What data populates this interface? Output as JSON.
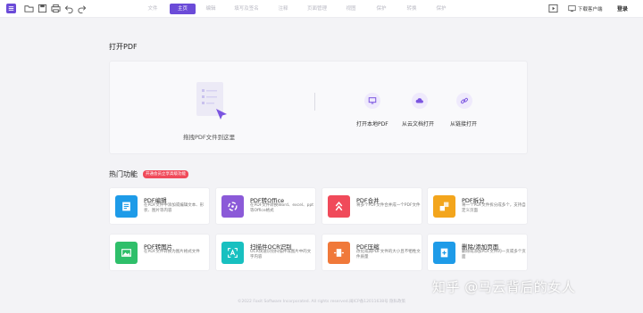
{
  "toolbar": {
    "icons": [
      "app-menu-icon",
      "open-folder-icon",
      "save-icon",
      "print-icon",
      "undo-icon",
      "redo-icon"
    ]
  },
  "menu": {
    "items": [
      "文件",
      "主页",
      "编辑",
      "填写及签名",
      "注释",
      "页面管理",
      "视图",
      "保护",
      "转换",
      "保护"
    ],
    "active_index": 1
  },
  "header_right": {
    "download_label": "下载客户端",
    "login_label": "登录"
  },
  "open_pdf": {
    "title": "打开PDF",
    "drop_text": "拖拽PDF文件到这里",
    "sources": [
      {
        "label": "打开本地PDF",
        "icon": "monitor-icon"
      },
      {
        "label": "从云文档打开",
        "icon": "cloud-icon"
      },
      {
        "label": "从链接打开",
        "icon": "link-icon"
      }
    ]
  },
  "hot": {
    "title": "热门功能",
    "badge": "开通会员立享高级功能",
    "cards": [
      {
        "title": "PDF编辑",
        "desc": "在PDF文件中添加或编辑文本、形状、图片等内容",
        "icon": "edit-doc-icon",
        "color": "#1e9be8"
      },
      {
        "title": "PDF转Office",
        "desc": "在PDF文件转换Word、excel、ppt等Office格式",
        "icon": "convert-icon",
        "color": "#8b5ad8"
      },
      {
        "title": "PDF合并",
        "desc": "将多个PDF文件合并成一个PDF文件",
        "icon": "merge-icon",
        "color": "#f04a5a"
      },
      {
        "title": "PDF拆分",
        "desc": "将一个PDF文件拆分成多个，支持自定义页面",
        "icon": "split-icon",
        "color": "#f3a51c"
      },
      {
        "title": "PDF转图片",
        "desc": "在PDF文件转换为图片格式文件",
        "icon": "image-icon",
        "color": "#2fbf6a"
      },
      {
        "title": "扫描件OCR识别",
        "desc": "OCR快速识别扫描件或图片中的文字内容",
        "icon": "ocr-icon",
        "color": "#18c0c0"
      },
      {
        "title": "PDF压缩",
        "desc": "改化或减PDF文件的大小且不牺牲文件质量",
        "icon": "compress-icon",
        "color": "#f0793a"
      },
      {
        "title": "删除/添加页面",
        "desc": "删除或添加PDF文件的一页或多个页面",
        "icon": "add-page-icon",
        "color": "#1e9be8"
      }
    ]
  },
  "footer": {
    "text": "©2022 Foxit Software Incorporated. All rights reserved.闽ICP备12011638号 隐私政策"
  },
  "watermark": "知乎 @马云背后的女人"
}
